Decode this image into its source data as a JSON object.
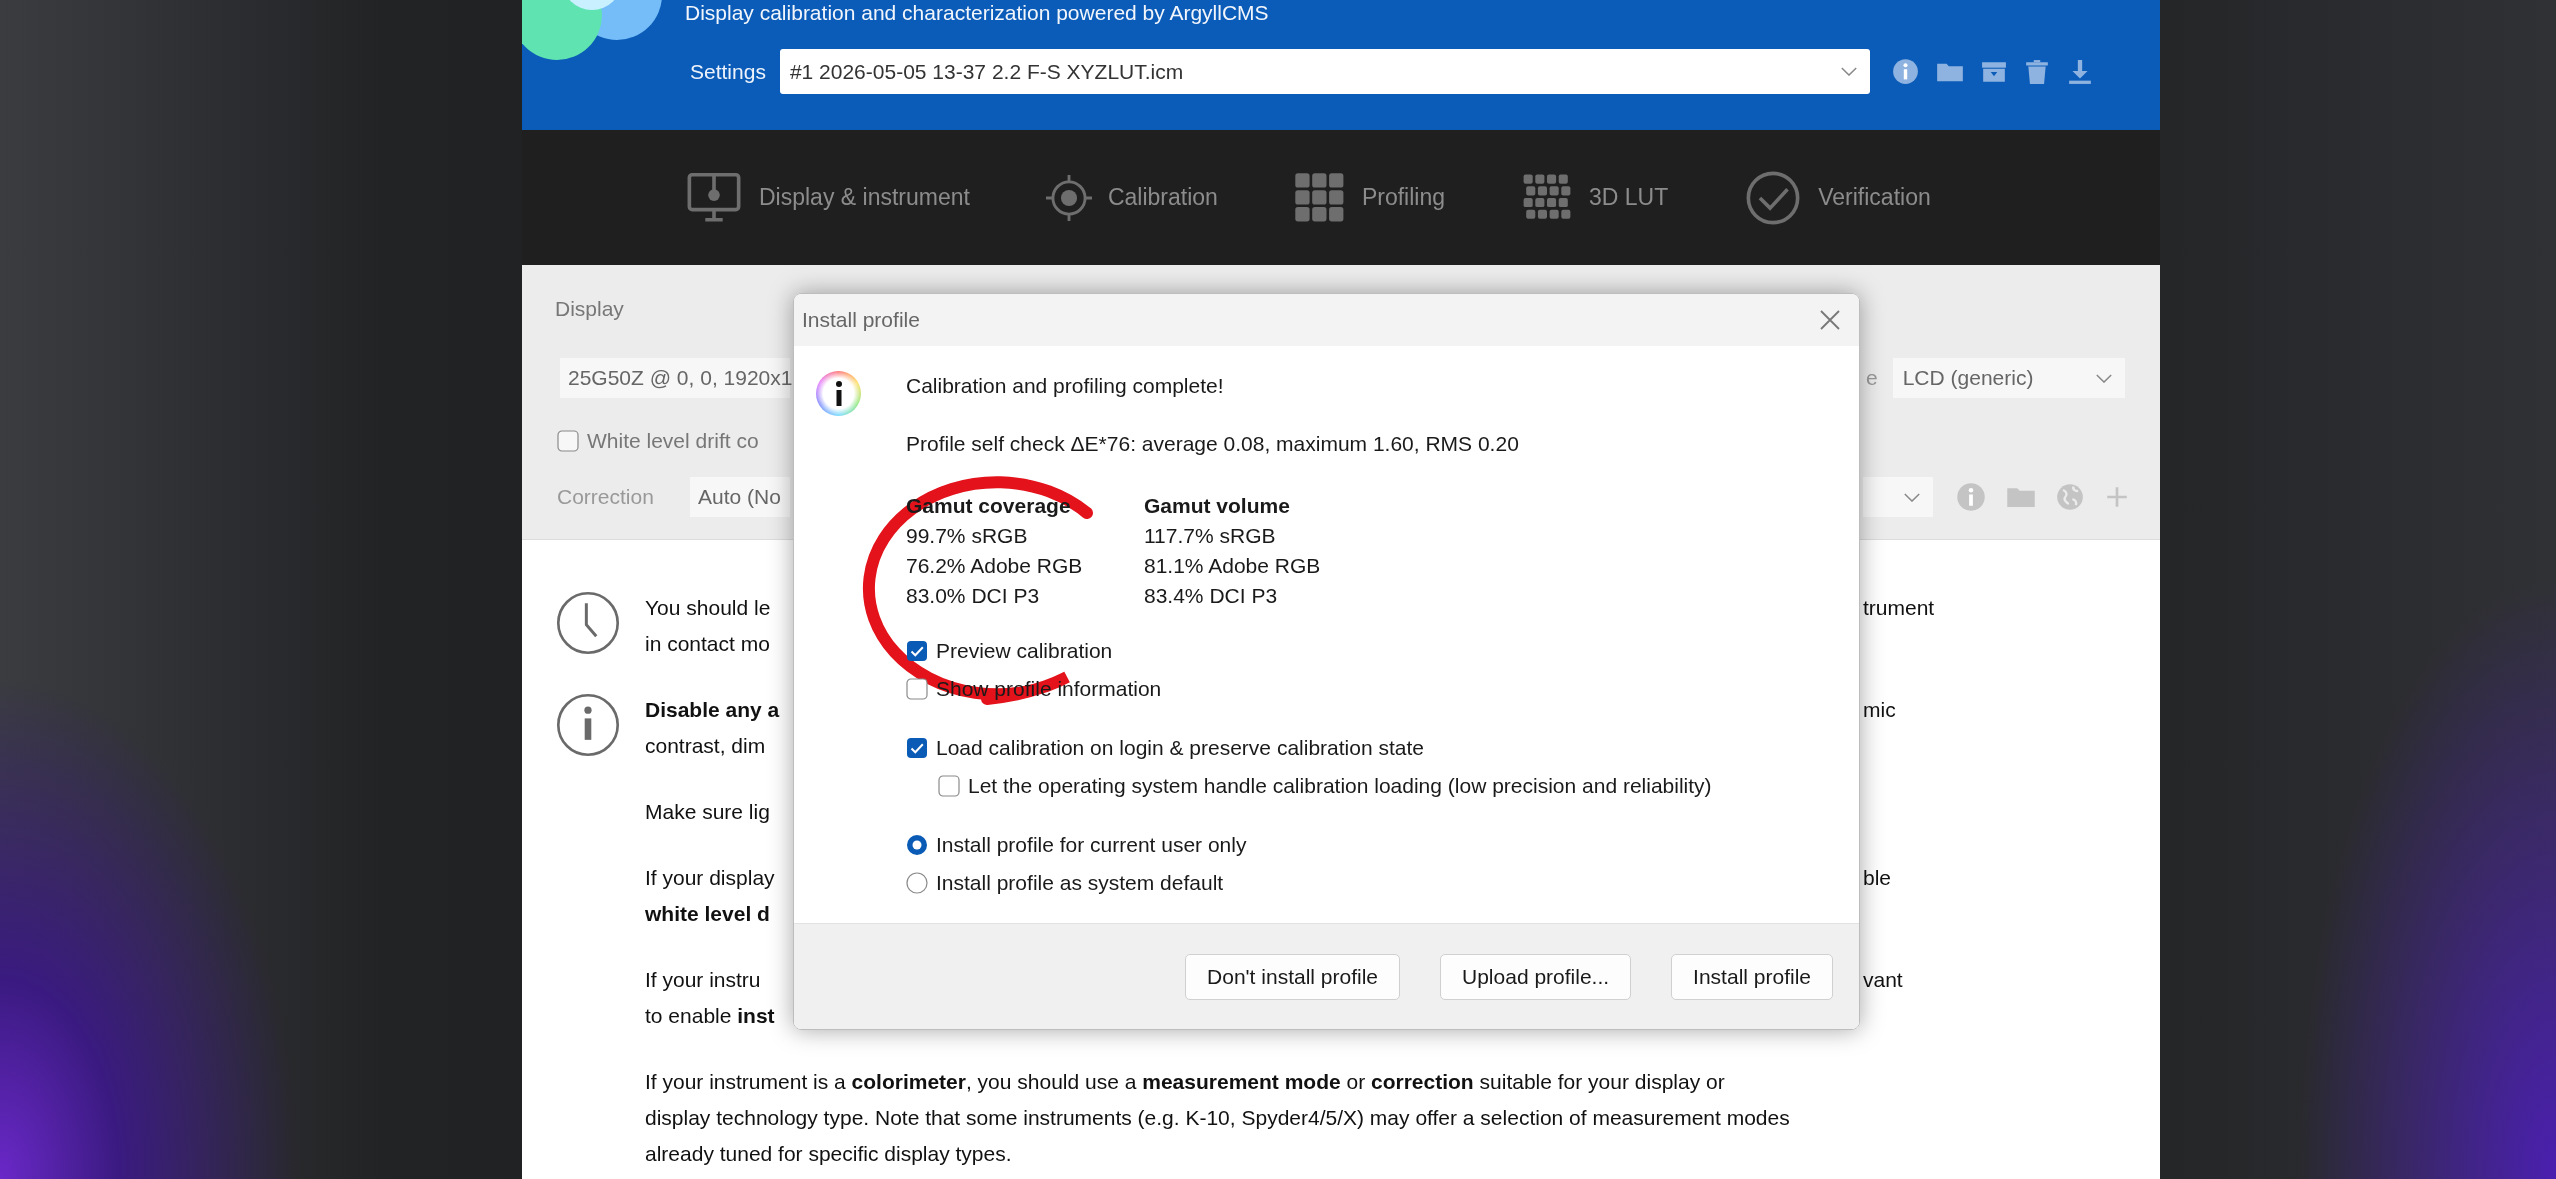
{
  "header": {
    "subtitle": "Display calibration and characterization powered by ArgyllCMS",
    "settings_label": "Settings",
    "settings_value": "#1 2026-05-05 13-37 2.2 F-S XYZLUT.icm"
  },
  "nav": [
    {
      "kind": "display",
      "label": "Display & instrument"
    },
    {
      "kind": "calibration",
      "label": "Calibration"
    },
    {
      "kind": "profiling",
      "label": "Profiling"
    },
    {
      "kind": "lut",
      "label": "3D LUT"
    },
    {
      "kind": "verification",
      "label": "Verification"
    }
  ],
  "display_section": {
    "title": "Display",
    "display_field": "25G50Z @ 0, 0, 1920x1",
    "mode_label": "e",
    "mode_value": "LCD (generic)",
    "drift_checkbox": {
      "label": "White level drift co",
      "checked": false
    },
    "correction_label": "Correction",
    "correction_value": "Auto (No"
  },
  "notes": [
    {
      "kind": "clock",
      "lines": [
        {
          "left": "You should le",
          "left_bold": false,
          "right": "trument"
        },
        {
          "left": "in contact mo",
          "left_bold": false
        }
      ]
    },
    {
      "kind": "info",
      "lines": [
        {
          "left": "Disable any a",
          "left_bold": true,
          "right": "mic"
        },
        {
          "left": "contrast, dim",
          "left_bold": false
        }
      ]
    },
    {
      "kind": "plain",
      "lines": [
        {
          "left": "Make sure lig",
          "left_bold": false
        }
      ]
    },
    {
      "kind": "plain",
      "lines": [
        {
          "left": "If your display",
          "left_bold": false,
          "right": "ble"
        },
        {
          "left": "white level d",
          "left_bold": true
        }
      ]
    },
    {
      "kind": "plain",
      "lines": [
        {
          "left": "If your instru",
          "left_bold": false,
          "right": "vant"
        },
        {
          "left": "to enable **inst**",
          "left_bold": false
        }
      ]
    },
    {
      "kind": "plain",
      "paragraph": [
        "If your instrument is a **colorimeter**, you should use a **measurement mode** or **correction** suitable for your display or",
        "display technology type. Note that some instruments (e.g. K-10, Spyder4/5/X) may offer a selection of measurement modes",
        "already tuned for specific display types."
      ]
    }
  ],
  "dialog": {
    "title": "Install profile",
    "heading": "Calibration and profiling complete!",
    "self_check": "Profile self check ΔE*76: average 0.08, maximum 1.60, RMS 0.20",
    "gamut": [
      {
        "title": "Gamut coverage",
        "values": [
          "99.7% sRGB",
          "76.2% Adobe RGB",
          "83.0% DCI P3"
        ]
      },
      {
        "title": "Gamut volume",
        "values": [
          "117.7% sRGB",
          "81.1% Adobe RGB",
          "83.4% DCI P3"
        ]
      }
    ],
    "option_groups": [
      [
        {
          "kind": "checkbox",
          "label": "Preview calibration",
          "checked": true
        },
        {
          "kind": "checkbox",
          "label": "Show profile information",
          "checked": false
        }
      ],
      [
        {
          "kind": "checkbox",
          "label": "Load calibration on login & preserve calibration state",
          "checked": true,
          "children": [
            {
              "kind": "checkbox",
              "label": "Let the operating system handle calibration loading (low precision and reliability)",
              "checked": false
            }
          ]
        }
      ],
      [
        {
          "kind": "radio",
          "label": "Install profile for current user only",
          "selected": true
        },
        {
          "kind": "radio",
          "label": "Install profile as system default",
          "selected": false
        }
      ]
    ],
    "buttons": [
      "Don't install profile",
      "Upload profile...",
      "Install profile"
    ]
  }
}
